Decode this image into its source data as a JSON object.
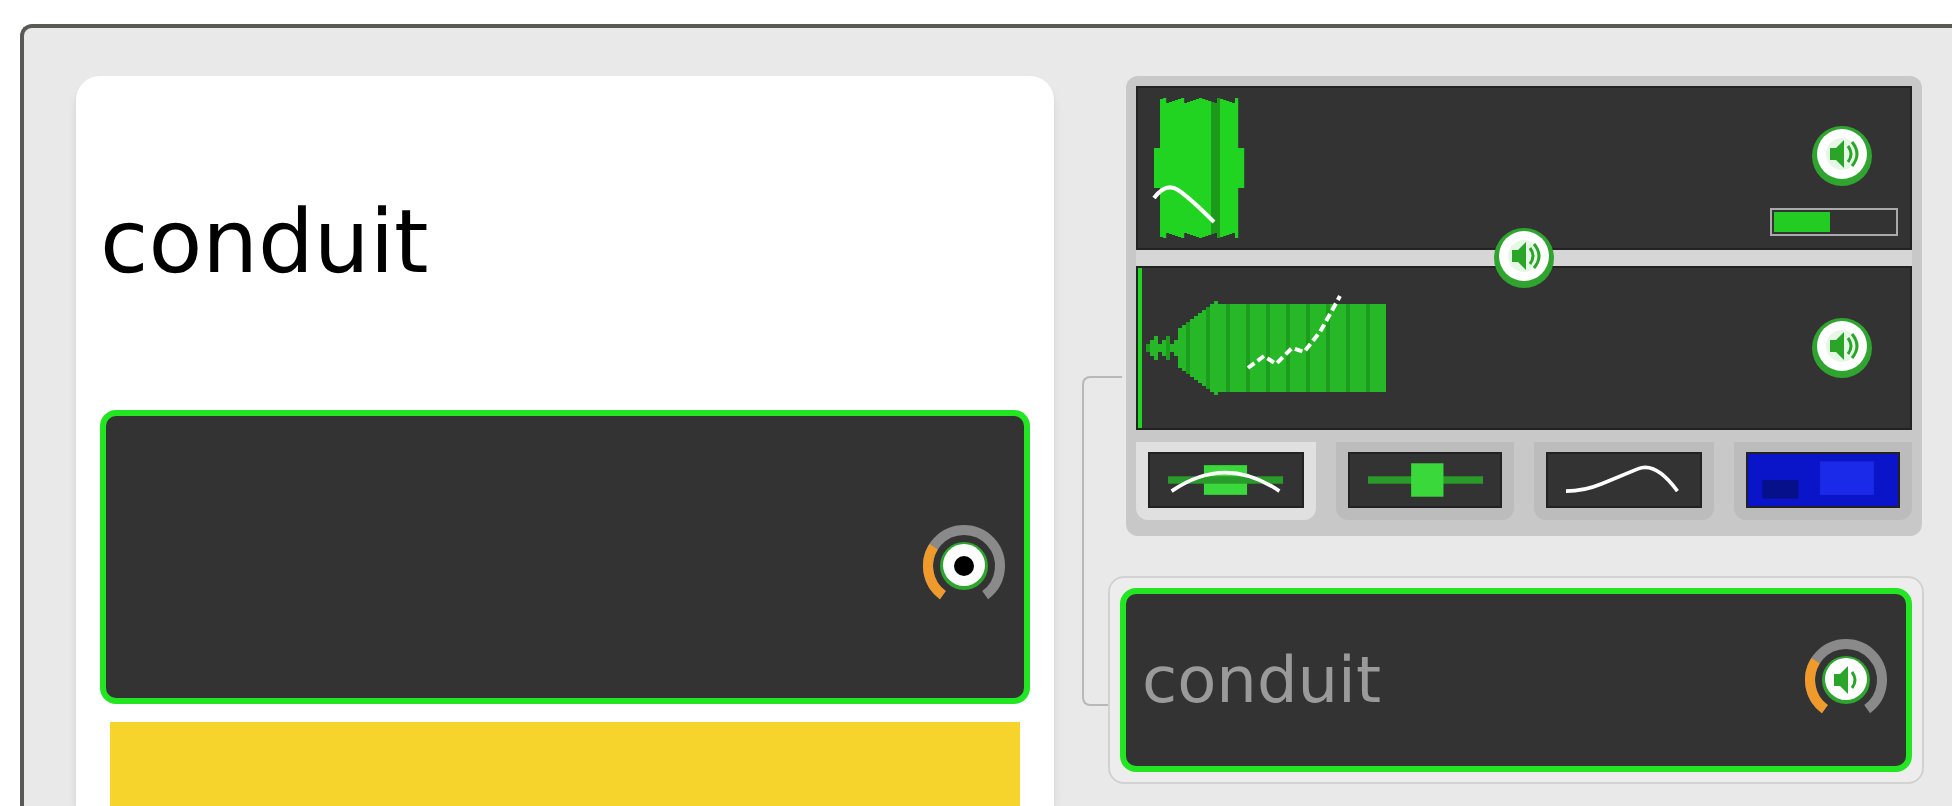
{
  "prompt_card": {
    "word": "conduit",
    "recorder": {
      "active": true,
      "knob": {
        "kind": "record"
      }
    }
  },
  "waveform_panel": {
    "reference": {
      "meter": {
        "level": 0.47
      }
    },
    "balance_slider": {
      "level": 0.5
    },
    "thumbnails": [
      {
        "kind": "combined",
        "selected": true
      },
      {
        "kind": "waveform",
        "selected": false
      },
      {
        "kind": "pitch",
        "selected": false
      },
      {
        "kind": "spectrogram",
        "selected": false
      }
    ]
  },
  "answer_card": {
    "word": "conduit",
    "active": true,
    "knob": {
      "kind": "play"
    }
  }
}
